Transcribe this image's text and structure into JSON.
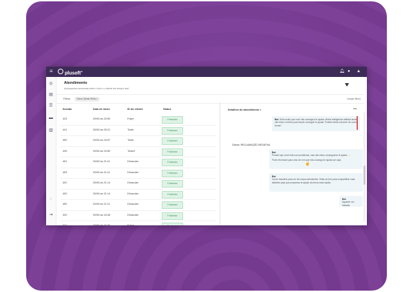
{
  "app": {
    "brand": "plusoft",
    "brand_suffix": "ai"
  },
  "page": {
    "title": "Atendimento",
    "subtitle": "Acompanhe conversas entre o bot e o cliente em tempo real."
  },
  "filters": {
    "label": "Filtros:",
    "chip": "Todos  Cliente Efeito  ×",
    "clear": "Limpar filtros"
  },
  "table": {
    "headers": [
      "Sessão",
      "Data de início",
      "ID do cliente",
      "Status"
    ],
    "rows": [
      {
        "session": "423",
        "date": "20/06 às 20:50",
        "client": "Fulpe",
        "status": "Finalizado"
      },
      {
        "session": "441",
        "date": "20/06 às 09:21",
        "client": "Tonte",
        "status": "Finalizado"
      },
      {
        "session": "450",
        "date": "20/06 às 15:57",
        "client": "Tonte",
        "status": "Finalizado"
      },
      {
        "session": "439",
        "date": "20/06 às 15:50",
        "client": "Tonte2",
        "status": "Finalizado"
      },
      {
        "session": "451",
        "date": "20/06 às 21:11",
        "client": "Dinacolar",
        "status": "Finalizado"
      },
      {
        "session": "453",
        "date": "20/06 às 21:11",
        "client": "Dinacolar",
        "status": "Finalizado"
      },
      {
        "session": "402",
        "date": "20/06 às 21:14",
        "client": "Dinacolar",
        "status": "Finalizado"
      },
      {
        "session": "400",
        "date": "20/06 às 21:14",
        "client": "Dinacolar",
        "status": "Finalizado"
      },
      {
        "session": "450",
        "date": "20/06 às 21:11",
        "client": "Dinacolar",
        "status": "Finalizado"
      },
      {
        "session": "320",
        "date": "20/06 às 16:46",
        "client": "Dinacolar",
        "status": "Finalizado"
      },
      {
        "session": "321",
        "date": "20/06 às 16:40",
        "client": "Fulpe",
        "status": "Finalizado"
      }
    ]
  },
  "details": {
    "title": "Detalhes do atendimento  >",
    "more": "•••",
    "classification": "Classe: RECLAMAÇÃO NEGATIVA",
    "messages": [
      {
        "who": "Bot:",
        "text": "Sinto muito que você não conseguiu te ajudar. Minha inteligência artificial ainda não tinha o melhor para dando conseguir te ajudar. Poderia tentar escrever de outra forma?"
      },
      {
        "who": "Bot:",
        "text": "Percebi que você está com problemas, mas não estou conseguindo te ajudar.",
        "emoji": "☺",
        "text2": "Pode reformular para uma vez em que não consegui te ajudar por aqui."
      },
      {
        "who": "Bot:",
        "text": "Vou te transferir para um de nossos atendentes. Sinta-se livre para compartilhar mais detalhes para que possamos te ajudar da forma mais rápida."
      },
      {
        "who": "Bot:",
        "text": "Aguarde um instante."
      }
    ]
  }
}
